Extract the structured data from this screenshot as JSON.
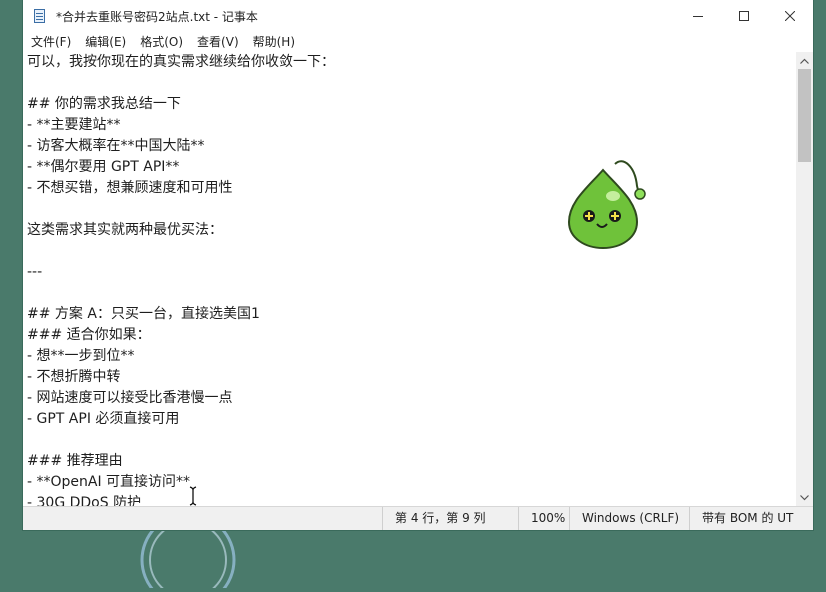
{
  "window": {
    "title": "*合并去重账号密码2站点.txt - 记事本"
  },
  "menu": [
    "文件(F)",
    "编辑(E)",
    "格式(O)",
    "查看(V)",
    "帮助(H)"
  ],
  "editor": {
    "lines": [
      "可以，我按你现在的真实需求继续给你收敛一下：",
      "",
      "## 你的需求我总结一下",
      "- **主要建站**",
      "- 访客大概率在**中国大陆**",
      "- **偶尔要用 GPT API**",
      "- 不想买错，想兼顾速度和可用性",
      "",
      "这类需求其实就两种最优买法：",
      "",
      "---",
      "",
      "## 方案 A：只买一台，直接选美国1",
      "### 适合你如果：",
      "- 想**一步到位**",
      "- 不想折腾中转",
      "- 网站速度可以接受比香港慢一点",
      "- GPT API 必须直接可用",
      "",
      "### 推荐理由",
      "- **OpenAI 可直接访问**",
      "- 30G DDoS 防护"
    ]
  },
  "status": {
    "position": "第 4 行，第 9 列",
    "zoom": "100%",
    "line_ending": "Windows (CRLF)",
    "encoding": "带有 BOM 的 UT"
  },
  "colors": {
    "desktop": "#4a7a6b",
    "mascot_green": "#6fc23a"
  }
}
